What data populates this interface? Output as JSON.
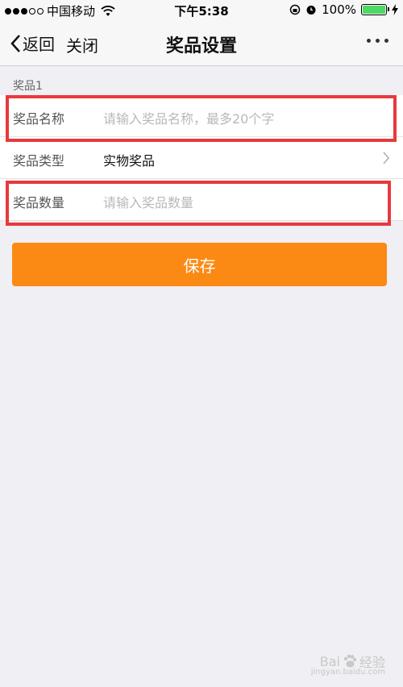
{
  "status_bar": {
    "carrier": "中国移动",
    "time": "下午5:38",
    "battery": "100%"
  },
  "nav": {
    "back": "返回",
    "close": "关闭",
    "title": "奖品设置"
  },
  "section": {
    "label": "奖品1"
  },
  "form": {
    "name_label": "奖品名称",
    "name_placeholder": "请输入奖品名称，最多20个字",
    "type_label": "奖品类型",
    "type_value": "实物奖品",
    "quantity_label": "奖品数量",
    "quantity_placeholder": "请输入奖品数量"
  },
  "save_button": "保存",
  "watermark": {
    "brand": "Bai",
    "brand2": "经验",
    "sub": "jingyan.baidu.com"
  },
  "colors": {
    "accent": "#fb8a14",
    "highlight": "#e8393c",
    "battery": "#4cd964"
  }
}
